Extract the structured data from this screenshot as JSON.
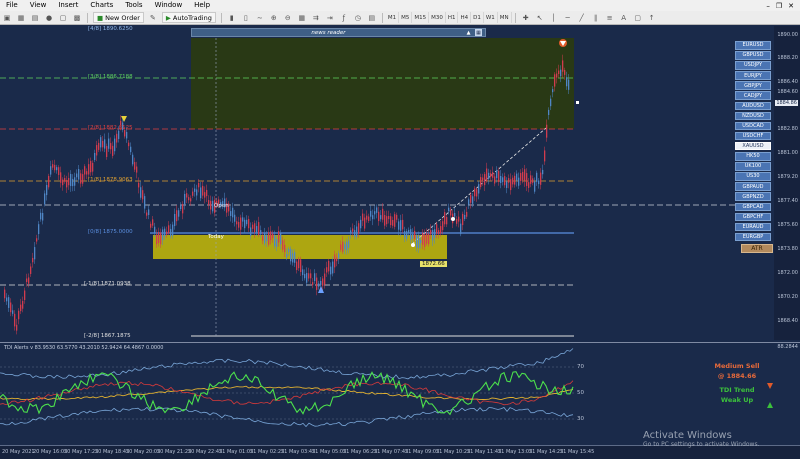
{
  "menu": {
    "items": [
      "File",
      "View",
      "Insert",
      "Charts",
      "Tools",
      "Window",
      "Help"
    ]
  },
  "toolbar": {
    "new_order": "New Order",
    "autotrading": "AutoTrading",
    "timeframes": [
      "M1",
      "M5",
      "M15",
      "M30",
      "H1",
      "H4",
      "D1",
      "W1",
      "MN"
    ]
  },
  "news": {
    "title": "news reader"
  },
  "fib_levels": [
    {
      "tag": "[4/8]",
      "price": "1890.6250",
      "color": "#8fb6e8"
    },
    {
      "tag": "[3/8]",
      "price": "1886.7188",
      "color": "#5fd35f"
    },
    {
      "tag": "[2/8]",
      "price": "1882.8125",
      "color": "#e04040"
    },
    {
      "tag": "[1/8]",
      "price": "1878.9063",
      "color": "#e0a030"
    },
    {
      "tag": "[0/8]",
      "price": "1875.0000",
      "color": "#5b8fe0"
    },
    {
      "tag": "[-1/8]",
      "price": "1871.0938",
      "color": "#e0e0e0"
    },
    {
      "tag": "[-2/8]",
      "price": "1867.1875",
      "color": "#e0e0e0"
    }
  ],
  "chart_labels": {
    "open": "Open",
    "today": "Today",
    "price_tag": "1872.66"
  },
  "price_axis": [
    "1890.00",
    "1888.20",
    "1886.40",
    "1884.60",
    "1882.80",
    "1881.00",
    "1879.20",
    "1877.40",
    "1875.60",
    "1873.80",
    "1872.00",
    "1870.20",
    "1868.40",
    "1866.60",
    "1884.86"
  ],
  "pairs": [
    "EURUSD",
    "GBPUSD",
    "USDJPY",
    "EURJPY",
    "GBPJPY",
    "CADJPY",
    "AUDUSD",
    "NZDUSD",
    "USDCAD",
    "USDCHF",
    "XAUUSD",
    "HK50",
    "UK100",
    "US30",
    "GBPAUD",
    "GBPNZD",
    "GBPCAD",
    "GBPCHF",
    "EURAUD",
    "EURGBP"
  ],
  "active_pair": "XAUUSD",
  "atr_label": "ATR",
  "indicator": {
    "title": "TDI Alerts v 83.9530 63.5770 43.2010 52.9424 64.4867 0.0000",
    "levels": [
      "88.2844",
      "70",
      "50",
      "30"
    ],
    "signal_sell": "Medium Sell",
    "signal_price": "@ 1884.66",
    "signal_trend": "TDI Trend",
    "signal_weak": "Weak Up"
  },
  "time_axis": [
    "20 May 2021",
    "20 May 16:05",
    "20 May 17:25",
    "20 May 18:45",
    "20 May 20:05",
    "20 May 21:25",
    "20 May 22:45",
    "21 May 01:05",
    "21 May 02:25",
    "21 May 03:45",
    "21 May 05:05",
    "21 May 06:25",
    "21 May 07:45",
    "21 May 09:05",
    "21 May 10:25",
    "21 May 11:45",
    "21 May 13:05",
    "21 May 14:25",
    "21 May 15:45"
  ],
  "watermark": {
    "line1": "Activate Windows",
    "line2": "Go to PC settings to activate Windows."
  },
  "colors": {
    "bg": "#1a2a4a",
    "bull": "#4f86c6",
    "bear": "#d23c4e",
    "box_yellow": "#b5ad0e",
    "box_dark": "#2a3a12"
  }
}
